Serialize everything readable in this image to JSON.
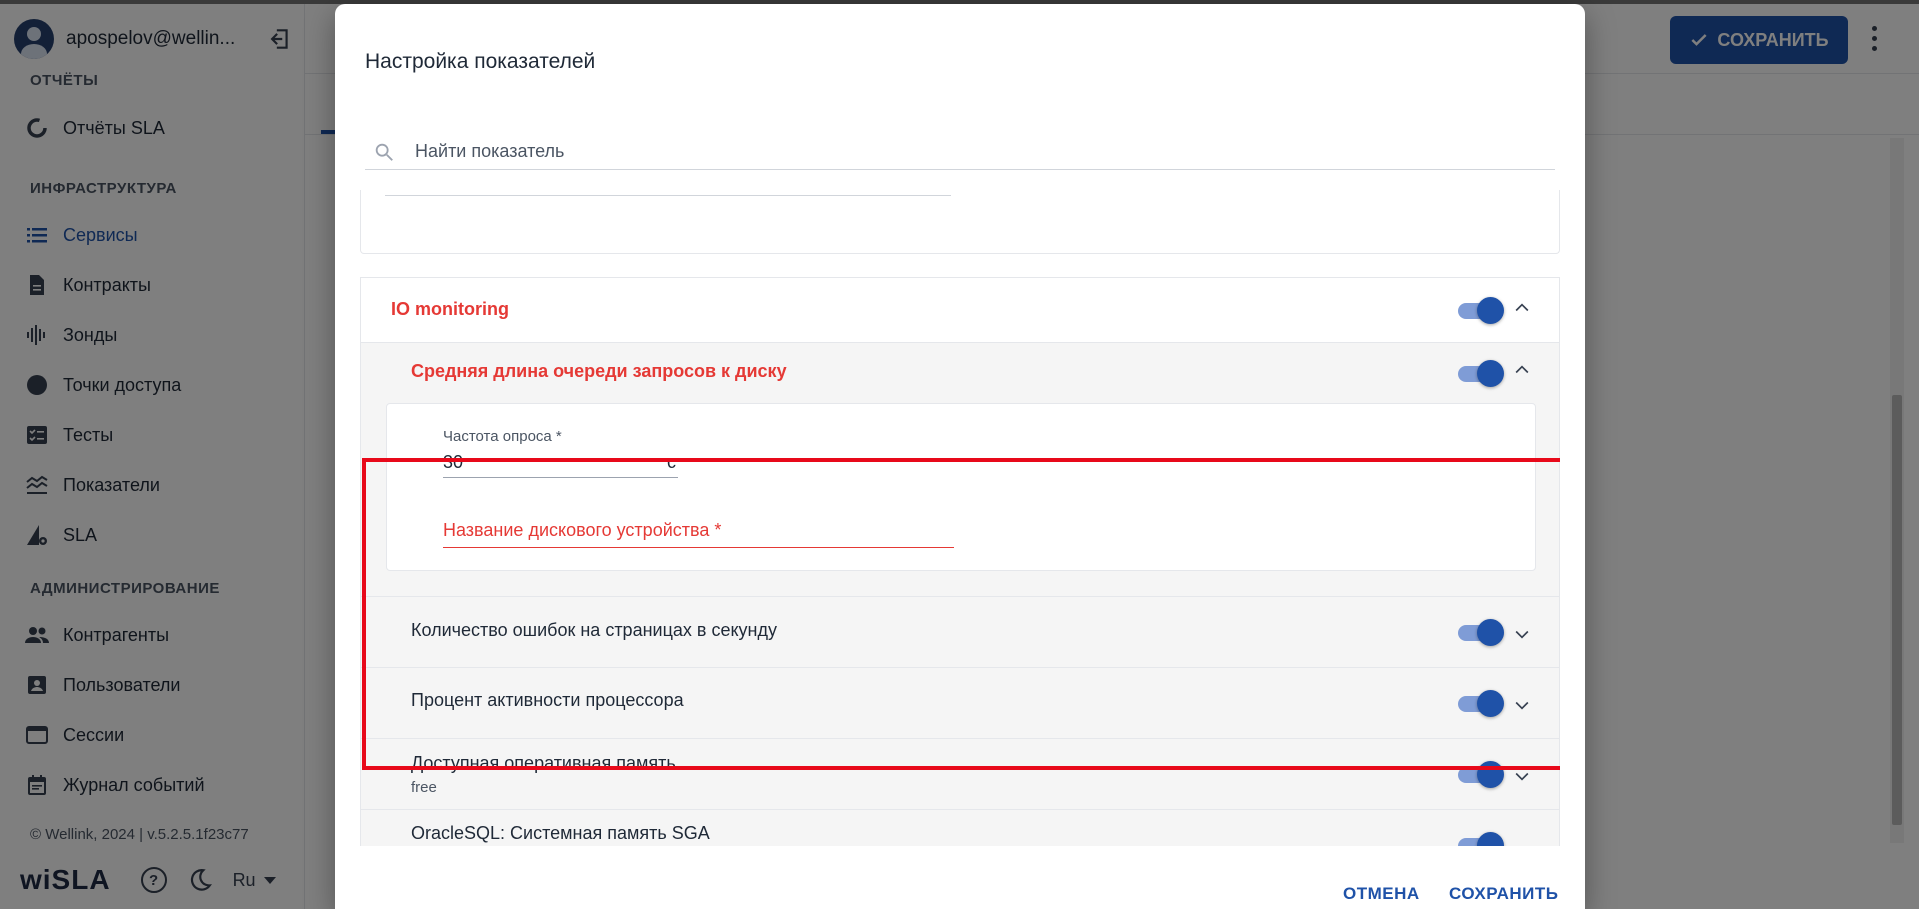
{
  "user": {
    "name": "apospelov@wellin..."
  },
  "sidebar": {
    "sections": [
      {
        "title": "ОТЧЁТЫ"
      },
      {
        "title": "ИНФРАСТРУКТУРА"
      },
      {
        "title": "АДМИНИСТРИРОВАНИЕ"
      }
    ],
    "items": [
      {
        "label": "Отчёты SLA",
        "icon": "donut-icon"
      },
      {
        "label": "Сервисы",
        "icon": "list-icon"
      },
      {
        "label": "Контракты",
        "icon": "document-icon"
      },
      {
        "label": "Зонды",
        "icon": "soundwave-icon"
      },
      {
        "label": "Точки доступа",
        "icon": "circle-icon"
      },
      {
        "label": "Тесты",
        "icon": "checklist-icon"
      },
      {
        "label": "Показатели",
        "icon": "chart-lines-icon"
      },
      {
        "label": "SLA",
        "icon": "sla-gear-icon"
      },
      {
        "label": "Контрагенты",
        "icon": "people-icon"
      },
      {
        "label": "Пользователи",
        "icon": "contact-icon"
      },
      {
        "label": "Сессии",
        "icon": "browser-icon"
      },
      {
        "label": "Журнал событий",
        "icon": "calendar-icon"
      }
    ],
    "footer": {
      "copyright": "© Wellink, 2024 | v.5.2.5.1f23c77",
      "logo": "wiSLA",
      "language": "Ru"
    }
  },
  "header": {
    "save_label": "СОХРАНИТЬ"
  },
  "modal": {
    "title": "Настройка показателей",
    "search": {
      "placeholder": "Найти показатель"
    },
    "group": {
      "title": "IO monitoring",
      "metrics": [
        {
          "title": "Средняя длина очереди запросов к диску",
          "expanded": true,
          "fields": {
            "poll_label": "Частота опроса *",
            "poll_value": "30",
            "poll_unit": "с",
            "device_label": "Название дискового устройства *"
          }
        },
        {
          "title": "Количество ошибок на страницах в секунду",
          "enabled": true
        },
        {
          "title": "Процент активности процессора",
          "enabled": true
        },
        {
          "title": "Доступная оперативная память",
          "subtitle": "free",
          "enabled": true
        },
        {
          "title": "OracleSQL: Системная память SGA",
          "enabled": true
        }
      ]
    },
    "cancel_label": "ОТМЕНА",
    "save_label": "СОХРАНИТЬ"
  },
  "colors": {
    "accent": "#1f52a8",
    "error": "#e53935",
    "highlight": "#e8091a"
  }
}
